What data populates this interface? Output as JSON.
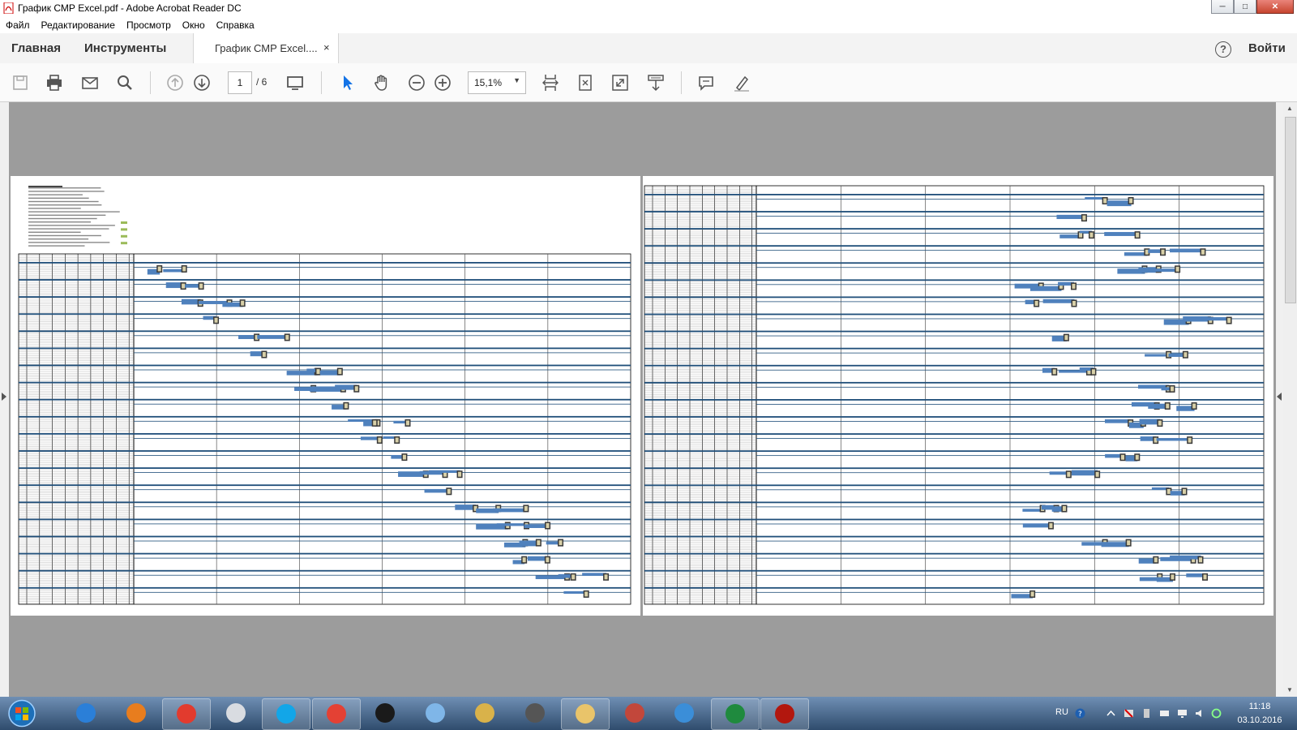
{
  "window": {
    "title": "График СМР Excel.pdf - Adobe Acrobat Reader DC"
  },
  "menu": [
    "Файл",
    "Редактирование",
    "Просмотр",
    "Окно",
    "Справка"
  ],
  "topnav": {
    "home": "Главная",
    "tools": "Инструменты",
    "signin": "Войти",
    "help": "?"
  },
  "tab": {
    "label": "График СМР Excel....",
    "close": "×"
  },
  "toolbar": {
    "page_current": "1",
    "page_total": "/ 6",
    "zoom": "15,1%"
  },
  "taskbar": {
    "apps": [
      "start-orb",
      "internet-explorer",
      "media-player",
      "yandex-browser",
      "calculator",
      "skype",
      "chrome",
      "hp",
      "computer",
      "scanner",
      "microphone",
      "folder",
      "agent",
      "paint",
      "excel",
      "acrobat"
    ],
    "lang": "RU",
    "time": "11:18",
    "date": "03.10.2016"
  },
  "colors": {
    "accent": "#1473e6",
    "bar": "#4f81bd",
    "grid": "#1f4e79"
  }
}
